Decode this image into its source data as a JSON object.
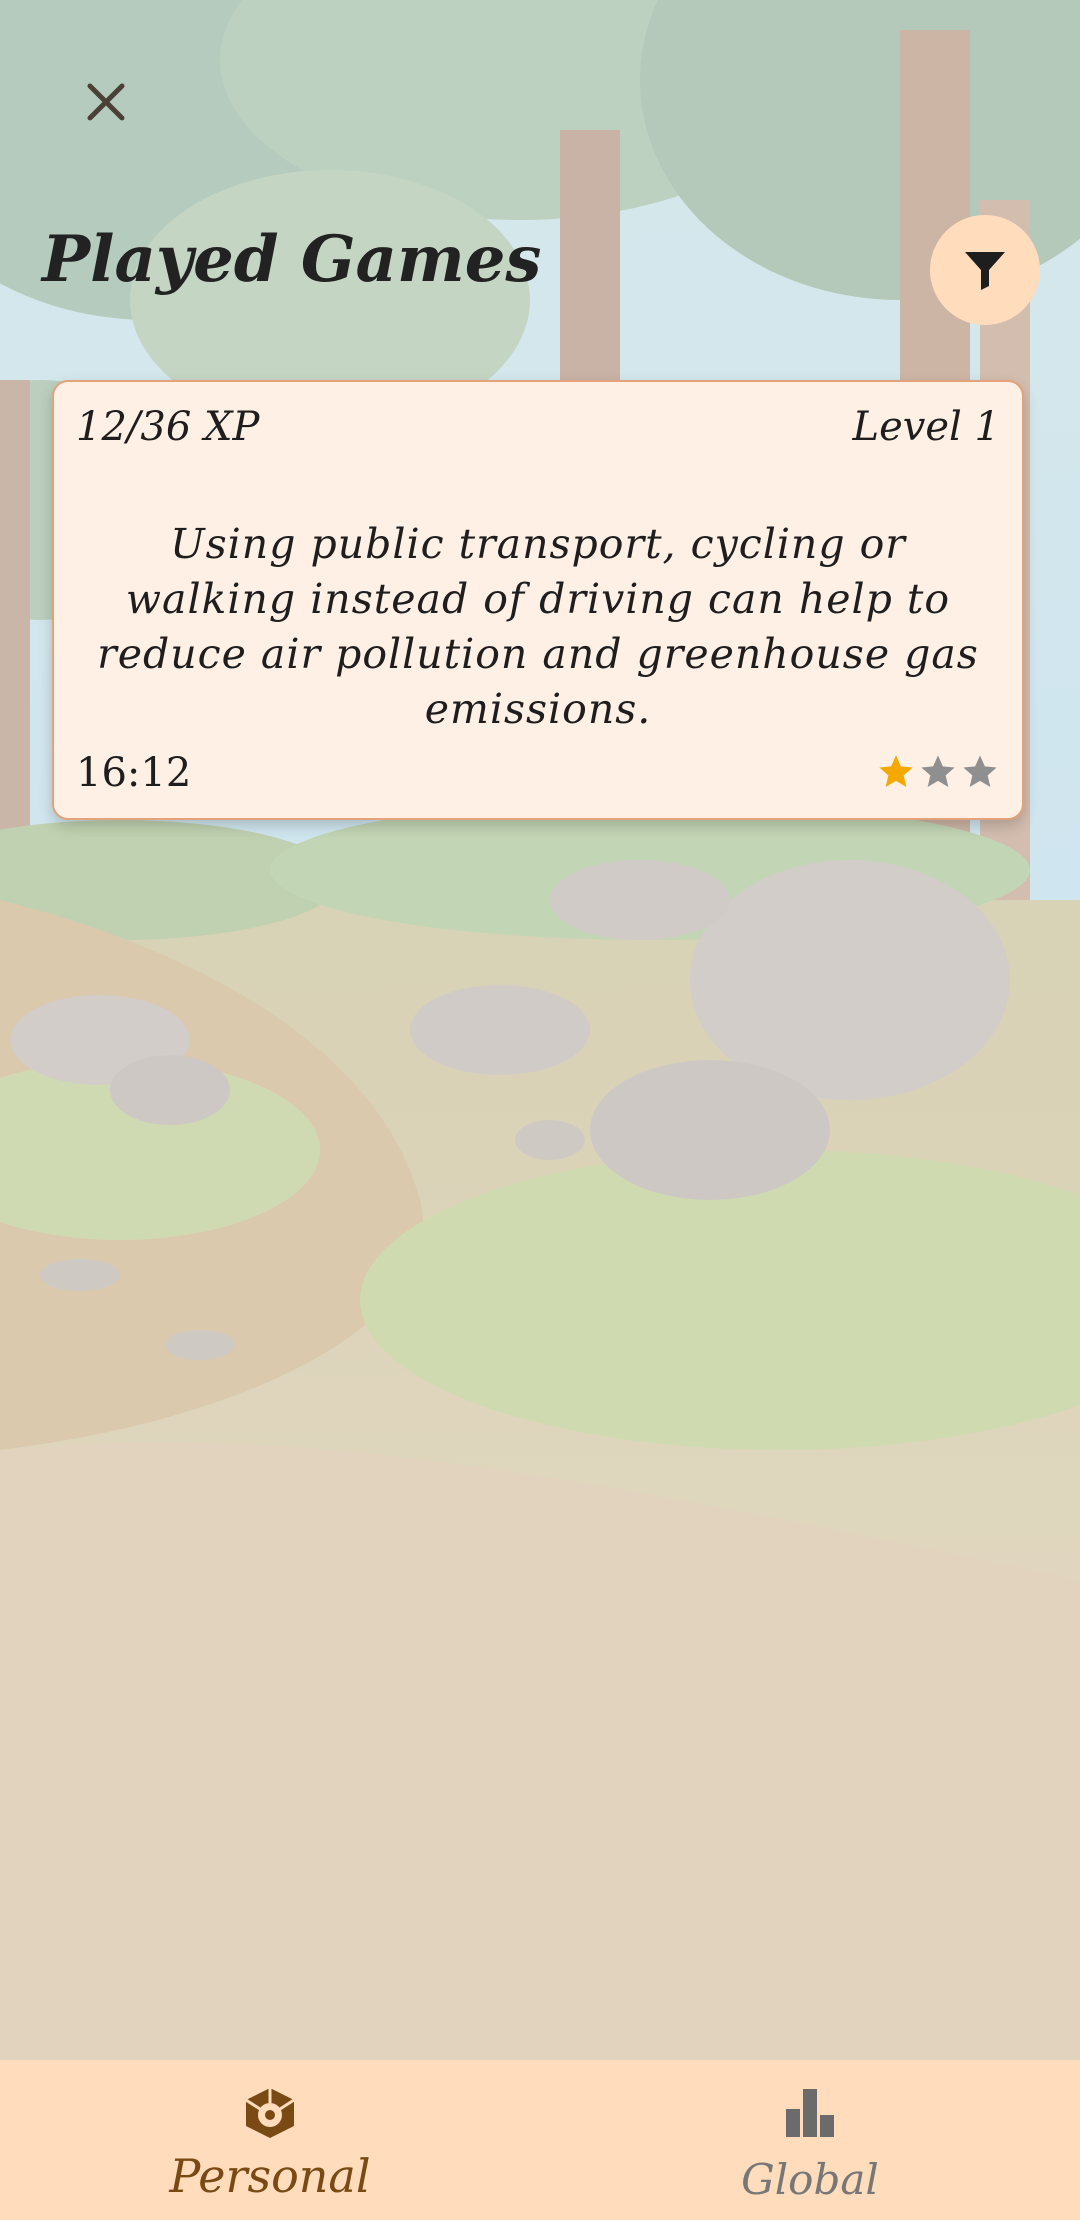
{
  "header": {
    "close_icon": "close-icon",
    "title": "Played Games",
    "filter_icon": "filter-icon"
  },
  "card": {
    "xp": "12/36 XP",
    "level": "Level 1",
    "fact": "Using public transport, cycling or walking instead of driving can help to reduce air pollution and greenhouse gas emissions.",
    "time": "16:12",
    "stars_earned": 1,
    "stars_total": 3
  },
  "bottom_nav": {
    "items": [
      {
        "label": "Personal",
        "icon": "personal-box-icon",
        "selected": true
      },
      {
        "label": "Global",
        "icon": "bar-chart-icon",
        "selected": false
      }
    ]
  },
  "colors": {
    "nav_background": "#ffdcbc",
    "card_background": "#fff0e6",
    "card_border": "#e3a27a",
    "star_filled": "#f5a800",
    "star_empty": "#8f8f8f",
    "selected_nav": "#7a4a14"
  }
}
